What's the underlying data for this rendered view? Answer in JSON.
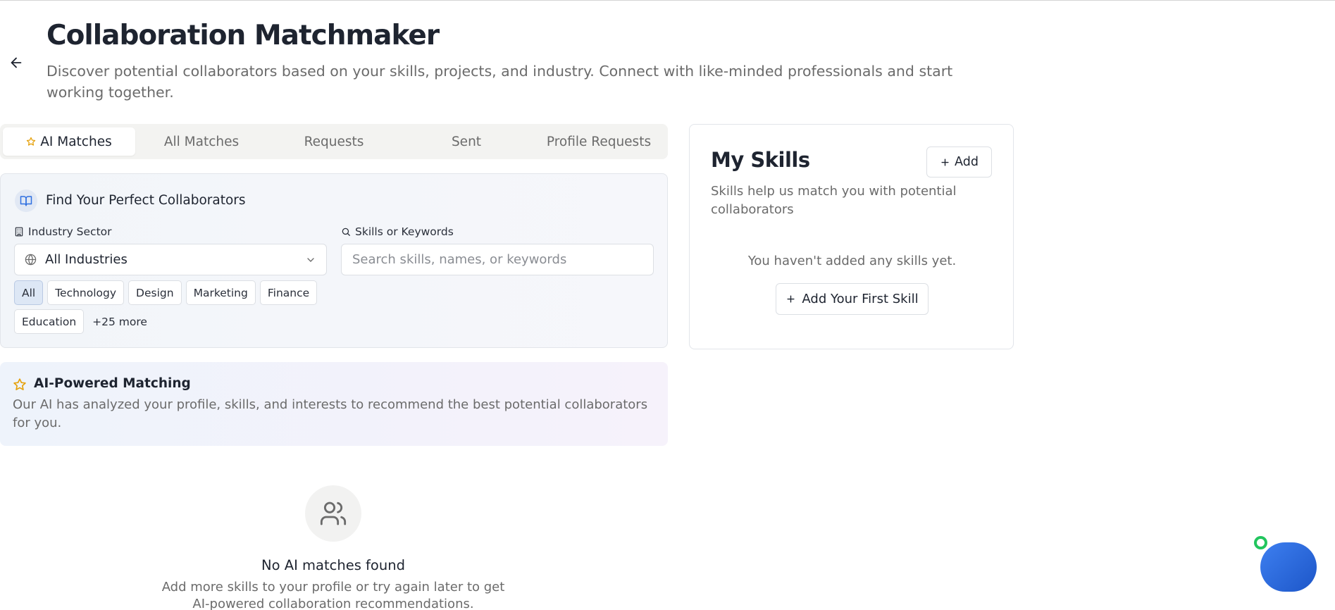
{
  "header": {
    "title": "Collaboration Matchmaker",
    "subtitle": "Discover potential collaborators based on your skills, projects, and industry. Connect with like-minded professionals and start working together."
  },
  "tabs": [
    {
      "label": "AI Matches",
      "active": true
    },
    {
      "label": "All Matches"
    },
    {
      "label": "Requests"
    },
    {
      "label": "Sent"
    },
    {
      "label": "Profile Requests"
    }
  ],
  "finder": {
    "title": "Find Your Perfect Collaborators",
    "industry_label": "Industry Sector",
    "industry_value": "All Industries",
    "keywords_label": "Skills or Keywords",
    "search_placeholder": "Search skills, names, or keywords",
    "chips": [
      "All",
      "Technology",
      "Design",
      "Marketing",
      "Finance",
      "Education"
    ],
    "more_label": "+25 more"
  },
  "ai_card": {
    "title": "AI-Powered Matching",
    "description": "Our AI has analyzed your profile, skills, and interests to recommend the best potential collaborators for you."
  },
  "empty_state": {
    "title": "No AI matches found",
    "description": "Add more skills to your profile or try again later to get AI-powered collaboration recommendations."
  },
  "skills": {
    "title": "My Skills",
    "add_label": "Add",
    "description": "Skills help us match you with potential collaborators",
    "empty_text": "You haven't added any skills yet.",
    "first_skill_label": "Add Your First Skill"
  },
  "colors": {
    "accent_blue": "#2f6fe0",
    "star_gold": "#e5a10c",
    "status_green": "#22c55e"
  }
}
